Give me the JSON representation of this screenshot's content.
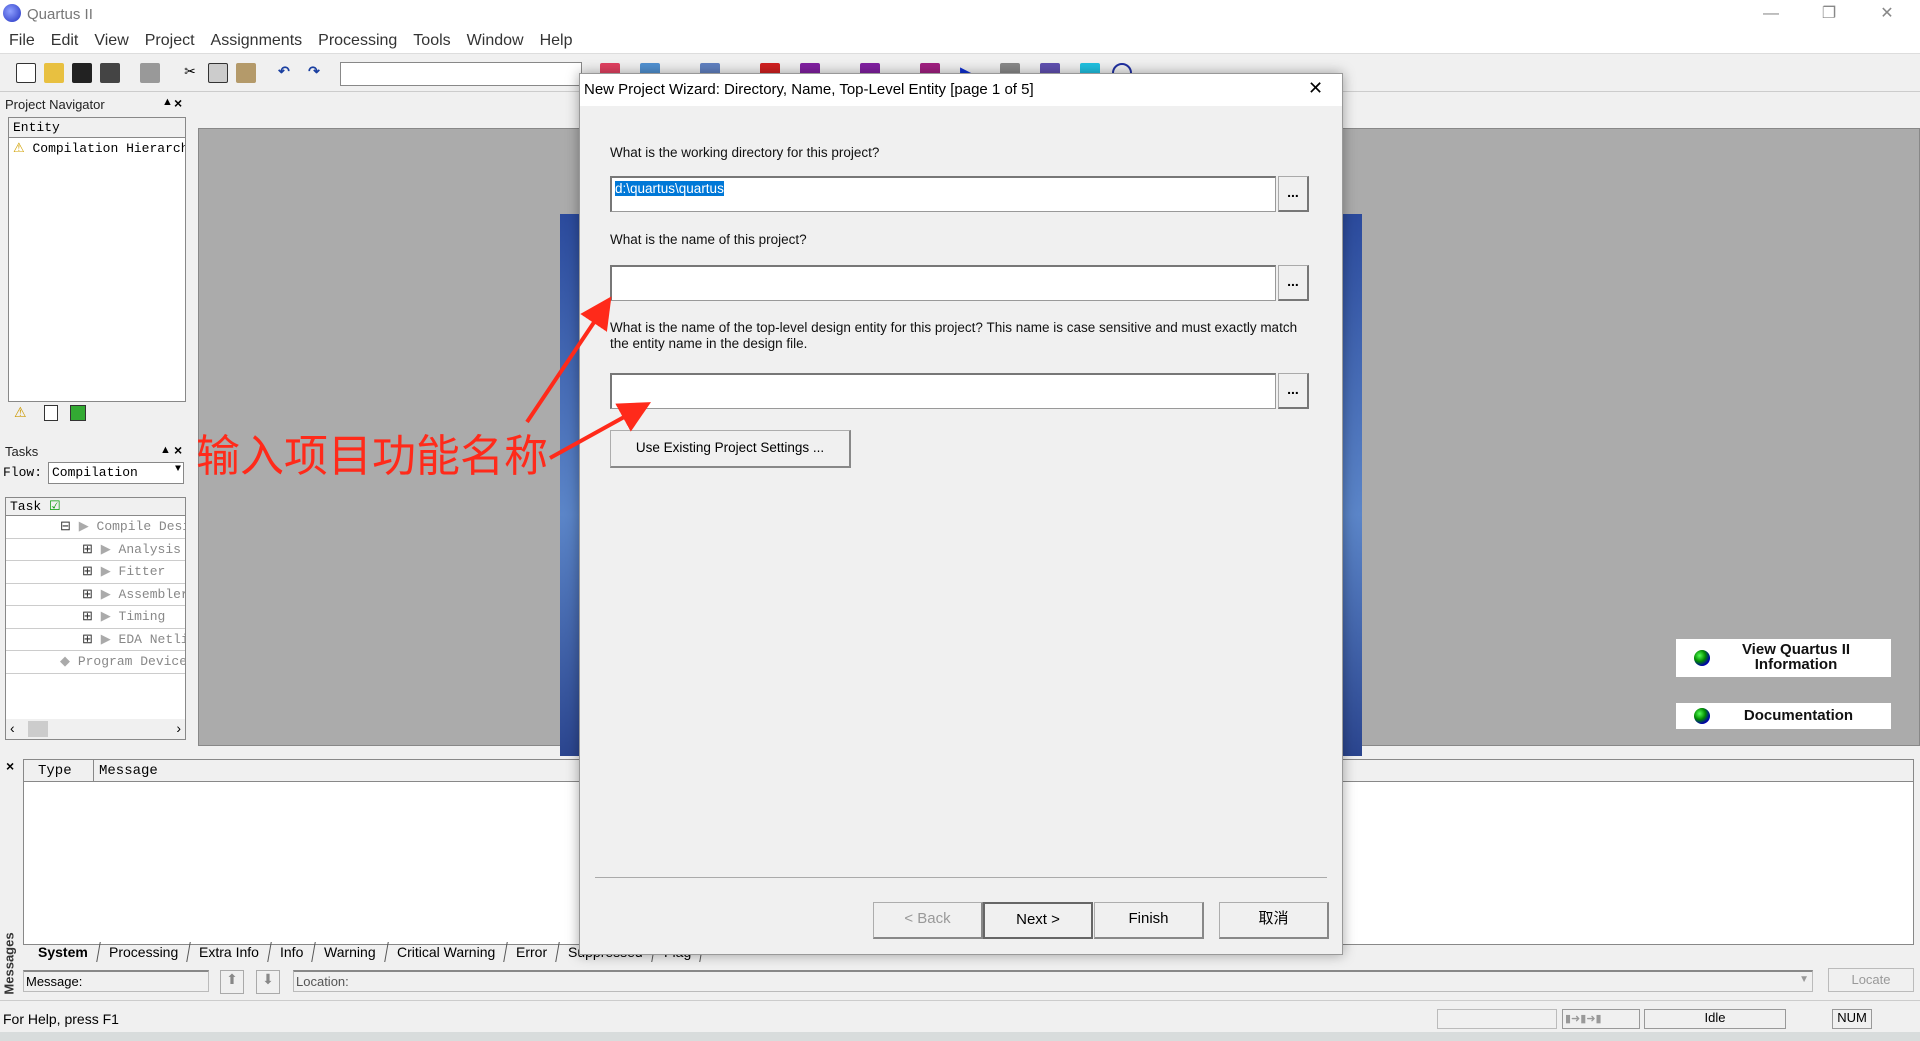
{
  "window": {
    "title": "Quartus II",
    "controls": [
      "minimize",
      "restore",
      "close"
    ]
  },
  "menu": [
    "File",
    "Edit",
    "View",
    "Project",
    "Assignments",
    "Processing",
    "Tools",
    "Window",
    "Help"
  ],
  "toolbar": {
    "icons": [
      "new-file-icon",
      "open-icon",
      "save-icon",
      "save-all-icon",
      "print-icon",
      "cut-icon",
      "copy-icon",
      "paste-icon",
      "undo-icon",
      "redo-icon"
    ],
    "combo_value": "",
    "right_icons": [
      "chip-planner-icon",
      "pin-icon",
      "assign-icon",
      "settings-icon",
      "analyze-icon",
      "stop-icon",
      "start-analysis-icon",
      "start-fitter-icon",
      "start-assembler-icon",
      "timing-icon",
      "rtl-icon",
      "compile-icon",
      "report-icon",
      "netlist-icon",
      "programmer-icon",
      "help-icon"
    ]
  },
  "navigator": {
    "title": "Project Navigator",
    "column": "Entity",
    "items": [
      {
        "label": "Compilation Hierarchy",
        "icon": "warning-icon"
      }
    ]
  },
  "tasks": {
    "title": "Tasks",
    "flow_label": "Flow:",
    "flow_value": "Compilation",
    "column": "Task",
    "items": [
      {
        "label": "Compile Design",
        "level": 0,
        "expander": "minus"
      },
      {
        "label": "Analysis & Synthesis",
        "level": 1,
        "expander": "plus"
      },
      {
        "label": "Fitter",
        "level": 1,
        "expander": "plus"
      },
      {
        "label": "Assembler",
        "level": 1,
        "expander": "plus"
      },
      {
        "label": "Timing",
        "level": 1,
        "expander": "plus"
      },
      {
        "label": "EDA Netlist",
        "level": 1,
        "expander": "plus"
      },
      {
        "label": "Program Device",
        "level": 0,
        "expander": ""
      }
    ]
  },
  "welcome": {
    "view_info": "View Quartus II Information",
    "documentation": "Documentation"
  },
  "messages": {
    "side_label": "Messages",
    "columns": [
      "Type",
      "Message"
    ],
    "tabs": [
      "System",
      "Processing",
      "Extra Info",
      "Info",
      "Warning",
      "Critical Warning",
      "Error",
      "Suppressed",
      "Flag"
    ],
    "message_label": "Message:",
    "location_label": "Location:",
    "locate": "Locate"
  },
  "status": {
    "help": "For Help, press F1",
    "state": "Idle",
    "num": "NUM"
  },
  "dialog": {
    "title": "New Project Wizard: Directory, Name, Top-Level Entity [page 1 of 5]",
    "q_dir": "What is the working directory for this project?",
    "dir_value": "d:\\quartus\\quartus",
    "q_name": "What is the name of this project?",
    "name_value": "",
    "q_entity": "What is the name of the top-level design entity for this project? This name is case sensitive and must exactly match the entity name in the design file.",
    "entity_value": "",
    "browse": "...",
    "use_existing": "Use Existing Project Settings ...",
    "back": "< Back",
    "next": "Next >",
    "finish": "Finish",
    "cancel": "取消"
  },
  "annotation": {
    "text": "输入项目功能名称",
    "color": "#ff2a1a"
  }
}
